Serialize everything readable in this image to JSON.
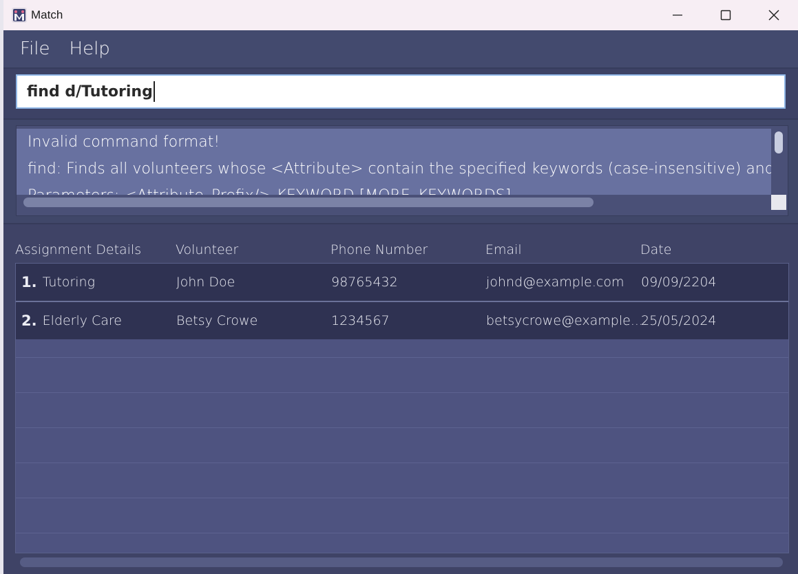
{
  "window": {
    "title": "Match"
  },
  "menu": {
    "items": [
      "File",
      "Help"
    ]
  },
  "command": {
    "value": "find d/Tutoring"
  },
  "result": {
    "lines": [
      "Invalid command format!",
      "find: Finds all volunteers whose <Attribute> contain the specified keywords (case-insensitive) and di",
      "Parameters: <Attribute_Prefix/> KEYWORD [MORE_KEYWORDS]..."
    ]
  },
  "table": {
    "headers": [
      "Assignment Details",
      "Volunteer",
      "Phone Number",
      "Email",
      "Date"
    ],
    "rows": [
      {
        "index": "1.",
        "details": "Tutoring",
        "volunteer": "John Doe",
        "phone": "98765432",
        "email": "johnd@example.com",
        "date": "09/09/2204"
      },
      {
        "index": "2.",
        "details": "Elderly Care",
        "volunteer": "Betsy Crowe",
        "phone": "1234567",
        "email": "betsycrowe@example....",
        "date": "25/05/2024"
      }
    ]
  },
  "icons": {
    "app": "app-logo-icon",
    "minimize": "minimize-icon",
    "maximize": "maximize-icon",
    "close": "close-icon"
  },
  "colors": {
    "background": "#3f4366",
    "result_text_bg": "#6871a0",
    "row_bg": "#2f3252",
    "empty_area": "#4e5380",
    "titlebar": "#f7eef4"
  }
}
